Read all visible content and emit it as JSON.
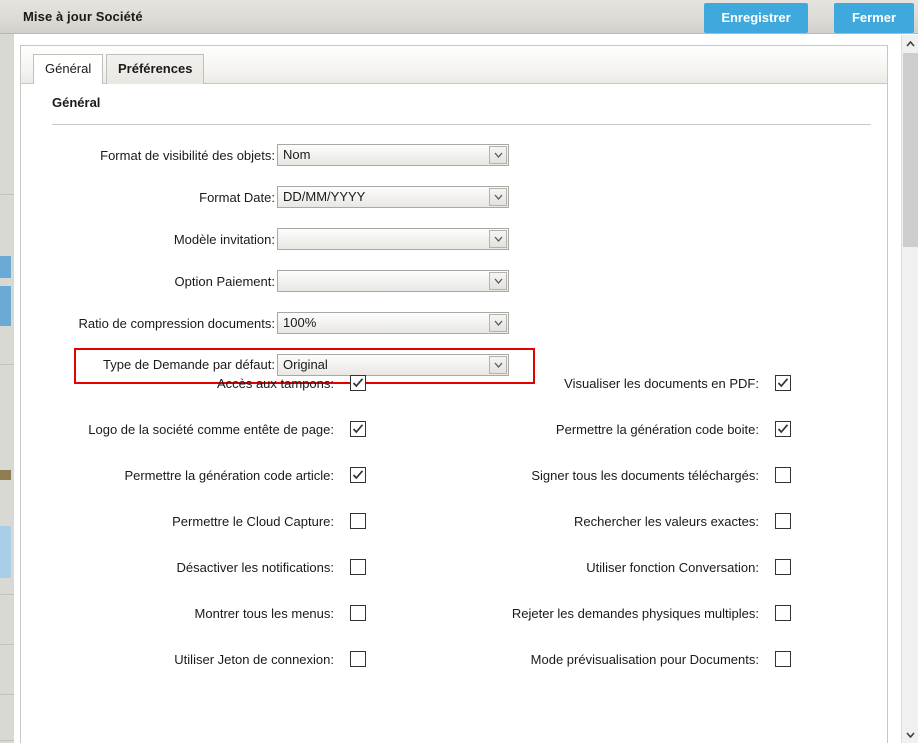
{
  "titlebar": {
    "title": "Mise à jour Société",
    "save_label": "Enregistrer",
    "close_label": "Fermer",
    "accent_color": "#3fa9dd"
  },
  "tabs": [
    {
      "label": "Général",
      "active": false
    },
    {
      "label": "Préférences",
      "active": true
    }
  ],
  "section": {
    "title": "Général"
  },
  "highlight": {
    "color": "#e60000"
  },
  "fields": [
    {
      "label": "Format de visibilité des objets:",
      "value": "Nom",
      "highlighted": false
    },
    {
      "label": "Format Date:",
      "value": "DD/MM/YYYY",
      "highlighted": false
    },
    {
      "label": "Modèle invitation:",
      "value": "",
      "highlighted": false
    },
    {
      "label": "Option Paiement:",
      "value": "",
      "highlighted": false
    },
    {
      "label": "Ratio de compression documents:",
      "value": "100%",
      "highlighted": false
    },
    {
      "label": "Type de Demande par défaut:",
      "value": "Original",
      "highlighted": true
    }
  ],
  "checkbox_rows": [
    {
      "left": {
        "label": "Accès aux tampons:",
        "checked": true
      },
      "right": {
        "label": "Visualiser les documents en PDF:",
        "checked": true
      }
    },
    {
      "left": {
        "label": "Logo de la société comme entête de page:",
        "checked": true
      },
      "right": {
        "label": "Permettre la génération code boite:",
        "checked": true
      }
    },
    {
      "left": {
        "label": "Permettre la génération code article:",
        "checked": true
      },
      "right": {
        "label": "Signer tous les documents téléchargés:",
        "checked": false
      }
    },
    {
      "left": {
        "label": "Permettre le Cloud Capture:",
        "checked": false
      },
      "right": {
        "label": "Rechercher les valeurs exactes:",
        "checked": false
      }
    },
    {
      "left": {
        "label": "Désactiver les notifications:",
        "checked": false
      },
      "right": {
        "label": "Utiliser fonction Conversation:",
        "checked": false
      }
    },
    {
      "left": {
        "label": "Montrer tous les menus:",
        "checked": false
      },
      "right": {
        "label": "Rejeter les demandes physiques multiples:",
        "checked": false
      }
    },
    {
      "left": {
        "label": "Utiliser Jeton de connexion:",
        "checked": false
      },
      "right": {
        "label": "Mode prévisualisation pour Documents:",
        "checked": false
      }
    }
  ],
  "scrollbar": {
    "up_arrow": "chevron-up-icon",
    "down_arrow": "chevron-down-icon"
  }
}
